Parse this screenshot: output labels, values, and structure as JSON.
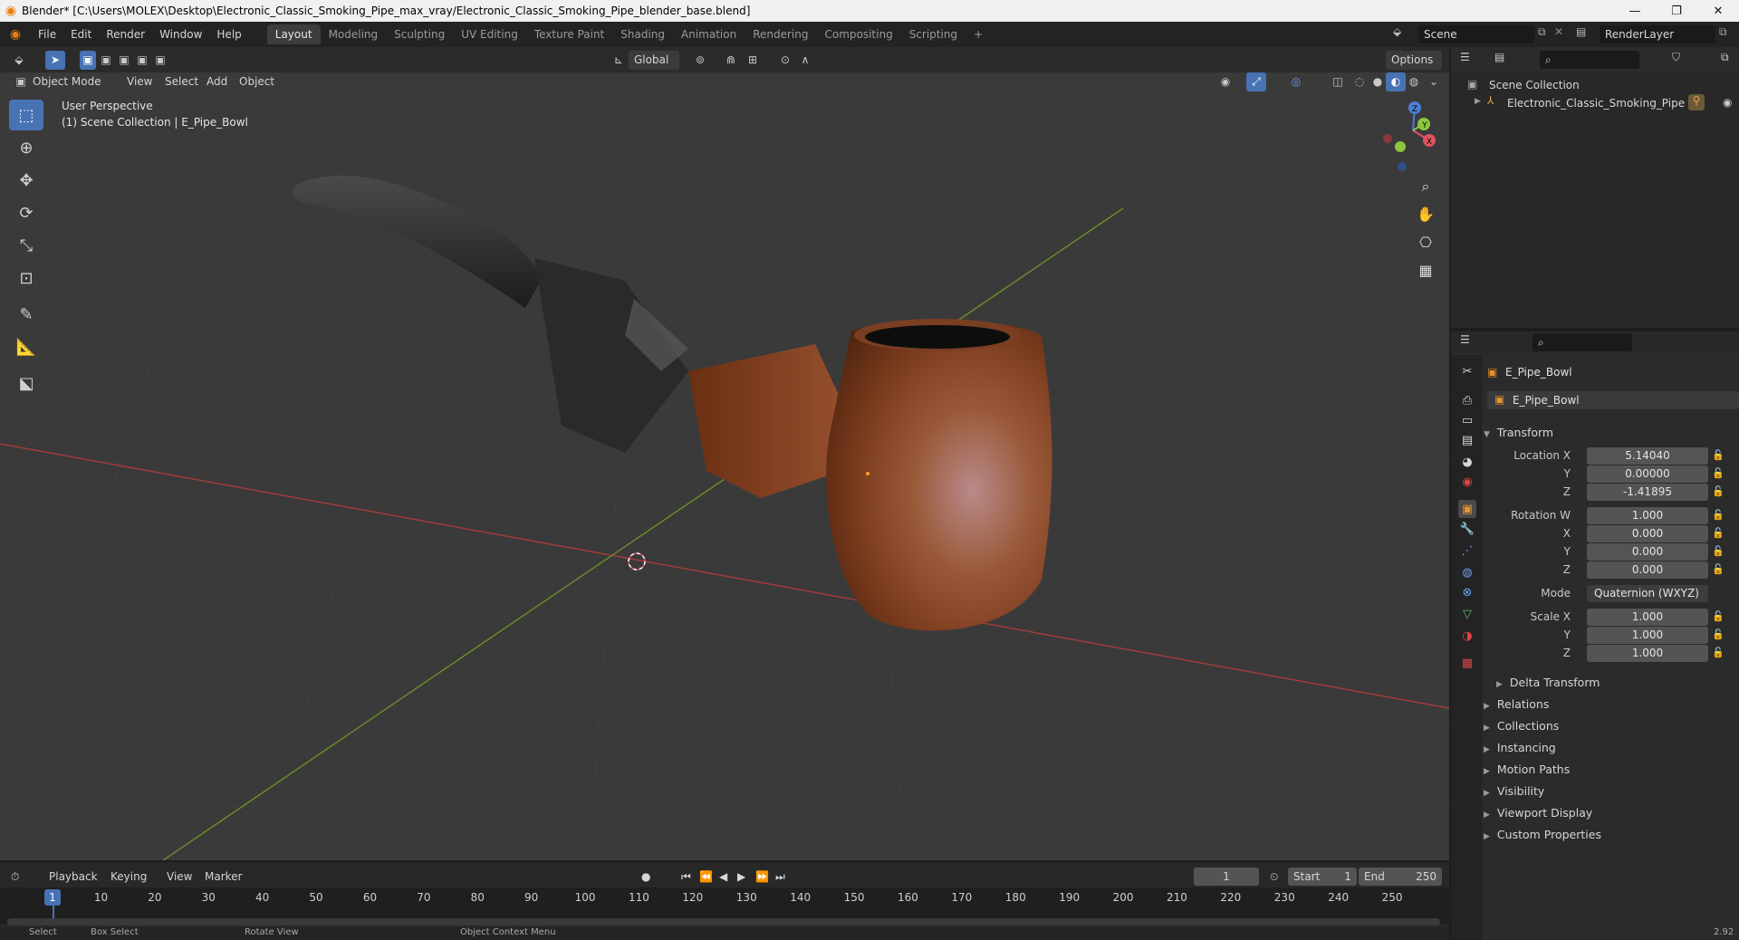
{
  "window": {
    "title": "Blender* [C:\\Users\\MOLEX\\Desktop\\Electronic_Classic_Smoking_Pipe_max_vray/Electronic_Classic_Smoking_Pipe_blender_base.blend]",
    "controls": [
      "—",
      "❐",
      "✕"
    ]
  },
  "menu": [
    "File",
    "Edit",
    "Render",
    "Window",
    "Help"
  ],
  "workspaces": [
    {
      "label": "Layout",
      "active": true
    },
    {
      "label": "Modeling"
    },
    {
      "label": "Sculpting"
    },
    {
      "label": "UV Editing"
    },
    {
      "label": "Texture Paint"
    },
    {
      "label": "Shading"
    },
    {
      "label": "Animation"
    },
    {
      "label": "Rendering"
    },
    {
      "label": "Compositing"
    },
    {
      "label": "Scripting"
    }
  ],
  "add_workspace": "+",
  "scene": {
    "label": "Scene",
    "render_layer": "RenderLayer"
  },
  "viewport_header": {
    "transform_orientation": "Global",
    "options": "Options",
    "mode": "Object Mode",
    "menus": [
      "View",
      "Select",
      "Add",
      "Object"
    ]
  },
  "viewport": {
    "perspective": "User Perspective",
    "collection_info": "(1) Scene Collection | E_Pipe_Bowl",
    "gizmo_axes": [
      "X",
      "Y",
      "Z"
    ]
  },
  "outliner": {
    "root": "Scene Collection",
    "items": [
      {
        "label": "Electronic_Classic_Smoking_Pipe"
      }
    ]
  },
  "properties": {
    "object_name": "E_Pipe_Bowl",
    "object_field": "E_Pipe_Bowl",
    "transform_label": "Transform",
    "location": {
      "label": "Location X",
      "x": "5.14040",
      "y_label": "Y",
      "y": "0.00000",
      "z_label": "Z",
      "z": "-1.41895"
    },
    "rotation": {
      "label": "Rotation W",
      "w": "1.000",
      "x_label": "X",
      "x": "0.000",
      "y_label": "Y",
      "y": "0.000",
      "z_label": "Z",
      "z": "0.000"
    },
    "mode": {
      "label": "Mode",
      "value": "Quaternion (WXYZ)"
    },
    "scale": {
      "label": "Scale X",
      "x": "1.000",
      "y_label": "Y",
      "y": "1.000",
      "z_label": "Z",
      "z": "1.000"
    },
    "delta_transform": "Delta Transform",
    "panels": [
      "Relations",
      "Collections",
      "Instancing",
      "Motion Paths",
      "Visibility",
      "Viewport Display",
      "Custom Properties"
    ]
  },
  "timeline": {
    "menus": [
      "Playback",
      "Keying",
      "View",
      "Marker"
    ],
    "current_frame": "1",
    "start_label": "Start",
    "start": "1",
    "end_label": "End",
    "end": "250",
    "ticks": [
      "1",
      "10",
      "20",
      "30",
      "40",
      "50",
      "60",
      "70",
      "80",
      "90",
      "100",
      "110",
      "120",
      "130",
      "140",
      "150",
      "160",
      "170",
      "180",
      "190",
      "200",
      "210",
      "220",
      "230",
      "240",
      "250"
    ]
  },
  "statusbar": [
    "Select",
    "Box Select",
    "Rotate View",
    "Object Context Menu",
    "2.92"
  ],
  "colors": {
    "accent": "#4772b3",
    "x_axis": "#e0525e",
    "y_axis": "#8cc63e",
    "z_axis": "#4a7fd6",
    "grid_x": "#a33b3b",
    "grid_y": "#6a8a2a"
  }
}
